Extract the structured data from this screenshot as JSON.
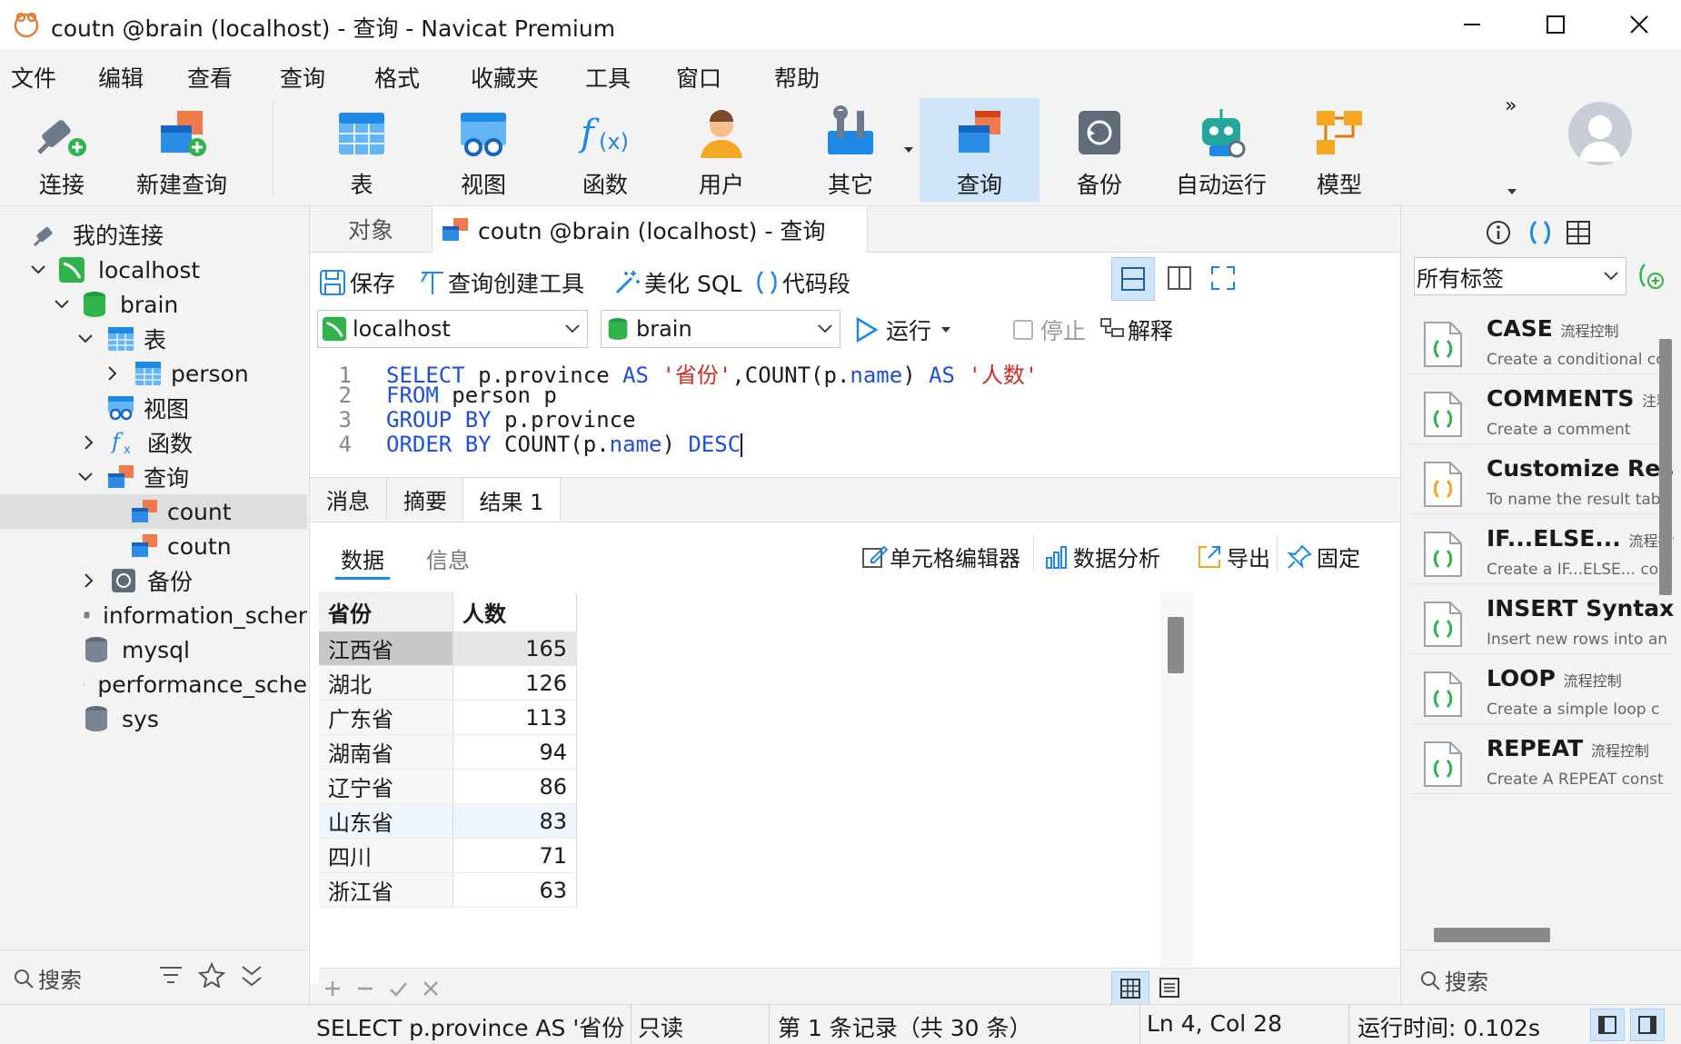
{
  "window": {
    "title": "coutn @brain (localhost) - 查询 - Navicat Premium"
  },
  "menu": [
    "文件",
    "编辑",
    "查看",
    "查询",
    "格式",
    "收藏夹",
    "工具",
    "窗口",
    "帮助"
  ],
  "toolbar": {
    "connect": "连接",
    "new_query": "新建查询",
    "table": "表",
    "view": "视图",
    "function": "函数",
    "user": "用户",
    "other": "其它",
    "query": "查询",
    "backup": "备份",
    "auto_run": "自动运行",
    "model": "模型",
    "overflow": "»"
  },
  "sidebar": {
    "root": "我的连接",
    "tree": {
      "localhost": "localhost",
      "brain": "brain",
      "tables": "表",
      "person": "person",
      "views": "视图",
      "functions": "函数",
      "queries": "查询",
      "count": "count",
      "coutn": "coutn",
      "backups": "备份",
      "information_schema": "information_scher",
      "mysql": "mysql",
      "performance_schema": "performance_sche",
      "sys": "sys"
    },
    "search_placeholder": "搜索"
  },
  "tabs": {
    "objects": "对象",
    "active": "coutn @brain (localhost) - 查询"
  },
  "editor_toolbar": {
    "save": "保存",
    "query_builder": "查询创建工具",
    "beautify": "美化 SQL",
    "snippet": "代码段"
  },
  "connection_bar": {
    "connection": "localhost",
    "database": "brain",
    "run": "运行",
    "stop": "停止",
    "explain": "解释"
  },
  "sql": {
    "lines": [
      "1",
      "2",
      "3",
      "4"
    ],
    "l1": {
      "kw1": "SELECT",
      "t1": " p.province ",
      "kw2": "AS",
      "s1": "'省份'",
      "t2": ",COUNT(p.",
      "n1": "name",
      "t3": ") ",
      "kw3": "AS",
      "s2": "'人数'"
    },
    "l2": {
      "kw1": "FROM",
      "t1": " person p"
    },
    "l3": {
      "kw1": "GROUP BY",
      "t1": " p.province"
    },
    "l4": {
      "kw1": "ORDER BY",
      "t1": " COUNT(p.",
      "n1": "name",
      "t2": ") ",
      "kw2": "DESC"
    }
  },
  "result_tabs": [
    "消息",
    "摘要",
    "结果 1"
  ],
  "result_subtabs": {
    "data": "数据",
    "info": "信息"
  },
  "result_toolbar": {
    "cell_editor": "单元格编辑器",
    "analysis": "数据分析",
    "export": "导出",
    "pin": "固定"
  },
  "grid": {
    "columns": [
      "省份",
      "人数"
    ],
    "rows": [
      [
        "江西省",
        "165"
      ],
      [
        "湖北",
        "126"
      ],
      [
        "广东省",
        "113"
      ],
      [
        "湖南省",
        "94"
      ],
      [
        "辽宁省",
        "86"
      ],
      [
        "山东省",
        "83"
      ],
      [
        "四川",
        "71"
      ],
      [
        "浙江省",
        "63"
      ]
    ]
  },
  "right_panel": {
    "filter": "所有标签",
    "snippets": [
      {
        "name": "CASE",
        "tag": "流程控制",
        "desc": "Create a conditional co"
      },
      {
        "name": "COMMENTS",
        "tag": "注释",
        "desc": "Create a comment"
      },
      {
        "name": "Customize Resu",
        "tag": "",
        "desc": "To name the result tab executing the statemen"
      },
      {
        "name": "IF...ELSE...",
        "tag": "流程控制",
        "desc": "Create a IF...ELSE... cons"
      },
      {
        "name": "INSERT Syntax",
        "tag": "",
        "desc": "Insert new rows into an"
      },
      {
        "name": "LOOP",
        "tag": "流程控制",
        "desc": "Create a simple loop c"
      },
      {
        "name": "REPEAT",
        "tag": "流程控制",
        "desc": "Create A REPEAT const Statement list is repeat search condition expre"
      }
    ],
    "search_placeholder": "搜索"
  },
  "status": {
    "sql": "SELECT p.province AS '省份',C(",
    "readonly": "只读",
    "record": "第 1 条记录（共 30 条）",
    "cursor": "Ln 4, Col 28",
    "runtime": "运行时间: 0.102s"
  },
  "colors": {
    "accent": "#1f4fd6",
    "string": "#d12b2b",
    "selected_tab": "#cfe6fa"
  }
}
